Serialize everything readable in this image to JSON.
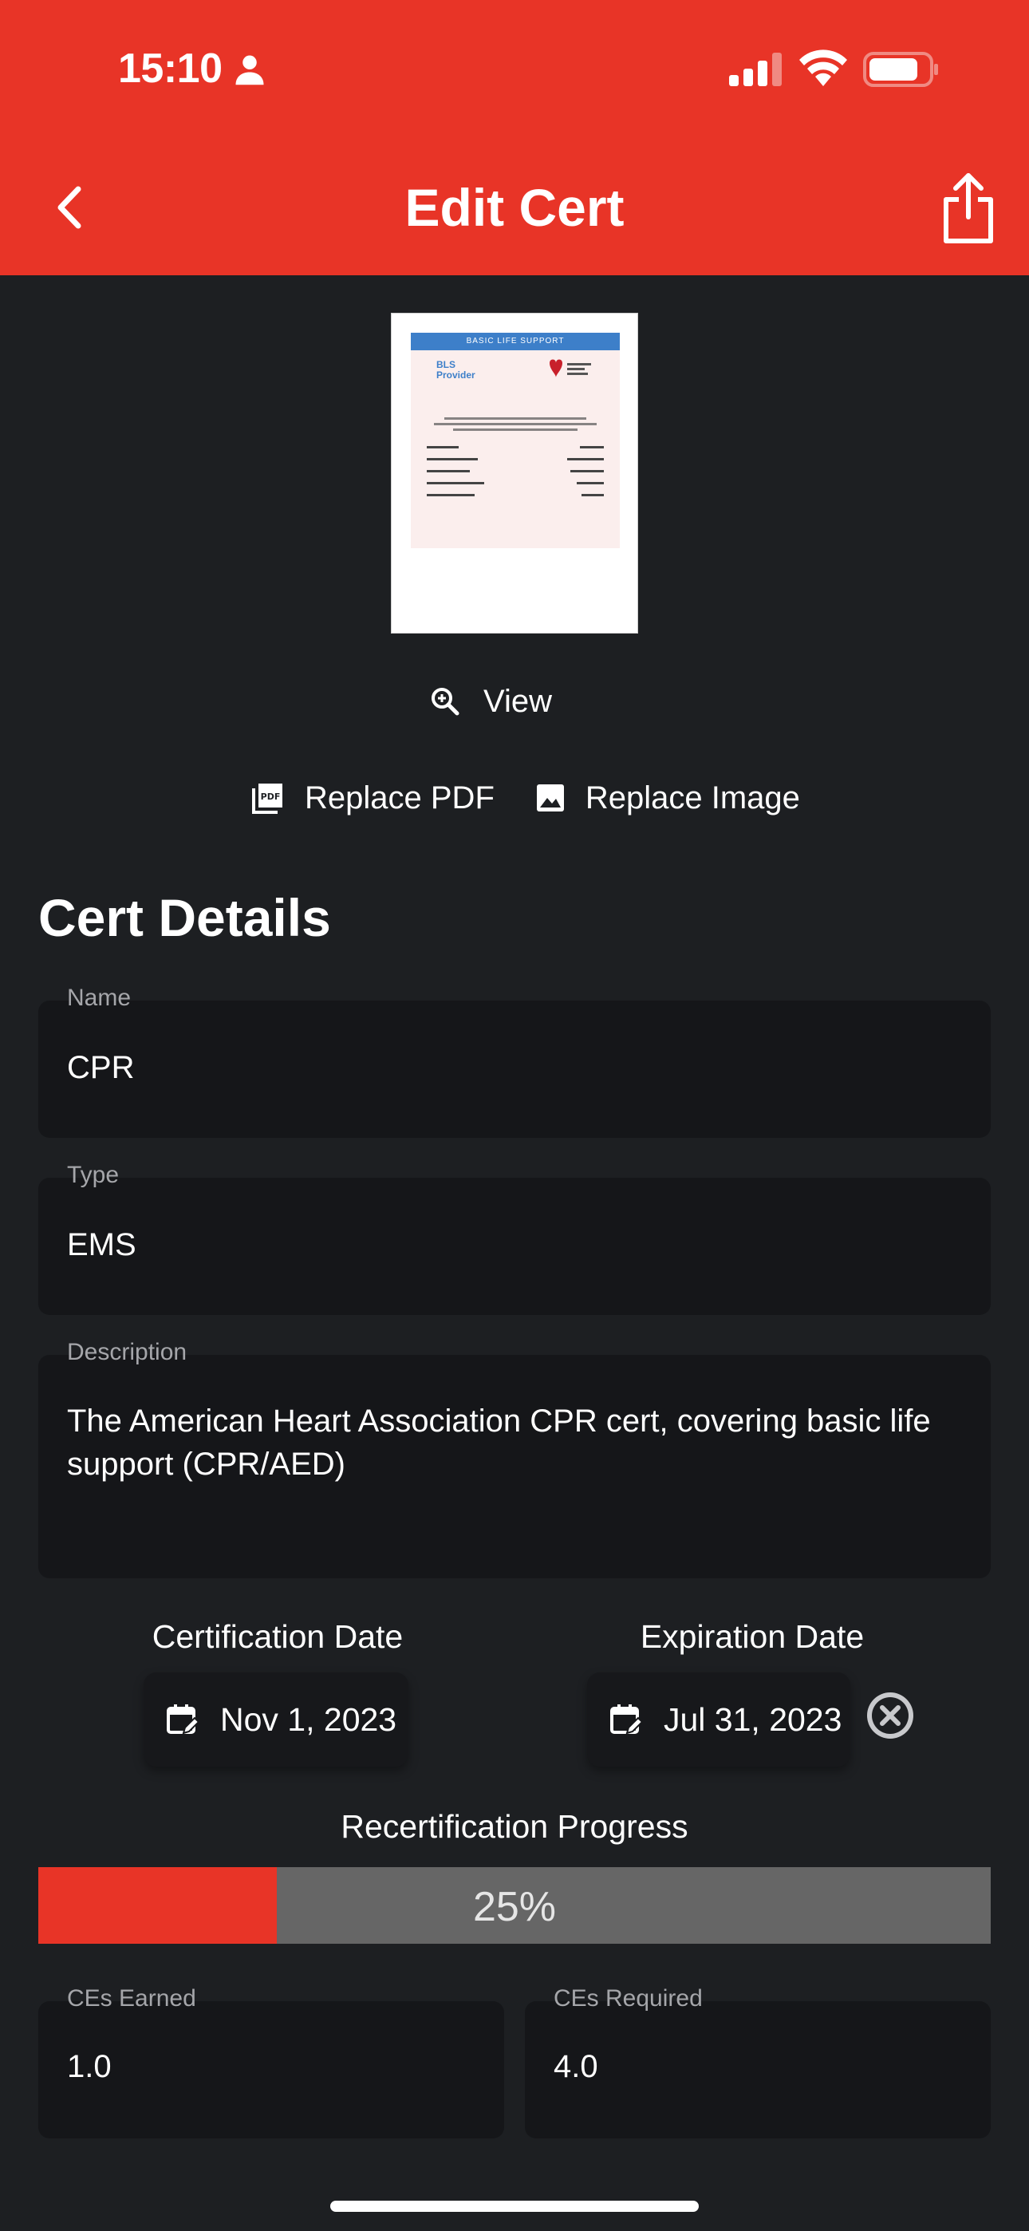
{
  "status_bar": {
    "time": "15:10"
  },
  "header": {
    "title": "Edit Cert",
    "back_icon": "chevron-left-icon",
    "share_icon": "share-icon"
  },
  "thumbnail": {
    "band_text": "BASIC LIFE SUPPORT",
    "title_line1": "BLS",
    "title_line2": "Provider"
  },
  "actions": {
    "view_label": "View",
    "replace_pdf_label": "Replace PDF",
    "replace_image_label": "Replace Image"
  },
  "section": {
    "title": "Cert Details"
  },
  "fields": {
    "name": {
      "label": "Name",
      "value": "CPR"
    },
    "type": {
      "label": "Type",
      "value": "EMS"
    },
    "description": {
      "label": "Description",
      "value": "The American Heart Association CPR cert, covering basic life support (CPR/AED)"
    }
  },
  "dates": {
    "certification": {
      "label": "Certification Date",
      "value": "Nov 1, 2023"
    },
    "expiration": {
      "label": "Expiration Date",
      "value": "Jul 31, 2023"
    }
  },
  "progress": {
    "label": "Recertification Progress",
    "percent": 25,
    "percent_text": "25%"
  },
  "ces": {
    "earned": {
      "label": "CEs Earned",
      "value": "1.0"
    },
    "required": {
      "label": "CEs Required",
      "value": "4.0"
    }
  },
  "colors": {
    "accent": "#e83427",
    "background": "#1d1f22",
    "field": "#151619",
    "progress_track": "#666666"
  }
}
